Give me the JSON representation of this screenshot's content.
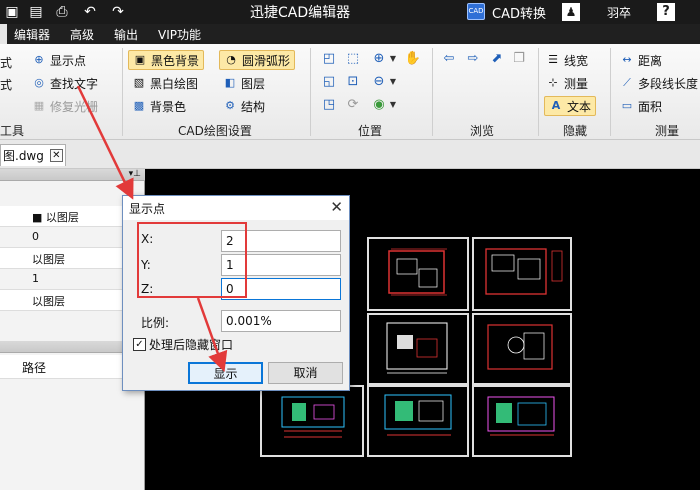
{
  "titlebar": {
    "title": "迅捷CAD编辑器",
    "cad_badge": "CAD",
    "convert_label": "CAD转换",
    "user_name": "羽卒",
    "help_label": "?"
  },
  "menu": [
    "编辑器",
    "高级",
    "输出",
    "VIP功能"
  ],
  "ribbon": {
    "left_cut": [
      "式",
      "式",
      "工具"
    ],
    "tools_col": [
      "显示点",
      "查找文字",
      "修复光栅"
    ],
    "cad_settings": {
      "items": [
        "黑色背景",
        "圆滑弧形",
        "黑白绘图",
        "图层",
        "背景色",
        "结构"
      ],
      "group_label": "CAD绘图设置"
    },
    "position_group_label": "位置",
    "browse_group_label": "浏览",
    "hide_group": {
      "items": [
        "线宽",
        "测量",
        "文本"
      ],
      "group_label": "隐藏"
    },
    "measure_group": {
      "items": [
        "距离",
        "多段线长度",
        "面积"
      ],
      "group_label": "测量"
    }
  },
  "document_tab": {
    "name": "图.dwg"
  },
  "left_panel": {
    "rows": [
      "以图层",
      "0",
      "以图层",
      "1",
      "以图层"
    ],
    "path_header": "路径"
  },
  "dialog": {
    "title": "显示点",
    "x_label": "X:",
    "y_label": "Y:",
    "z_label": "Z:",
    "x_value": "2",
    "y_value": "1",
    "z_value": "0",
    "scale_label": "比例:",
    "scale_value": "0.001%",
    "hide_after_label": "处理后隐藏窗口",
    "hide_after_checked": true,
    "ok_label": "显示",
    "cancel_label": "取消"
  },
  "colors": {
    "titlebar": "#1a1a1a",
    "canvas": "#000000",
    "highlight": "#e23a3a",
    "selected_tool": "#fde9a6"
  }
}
